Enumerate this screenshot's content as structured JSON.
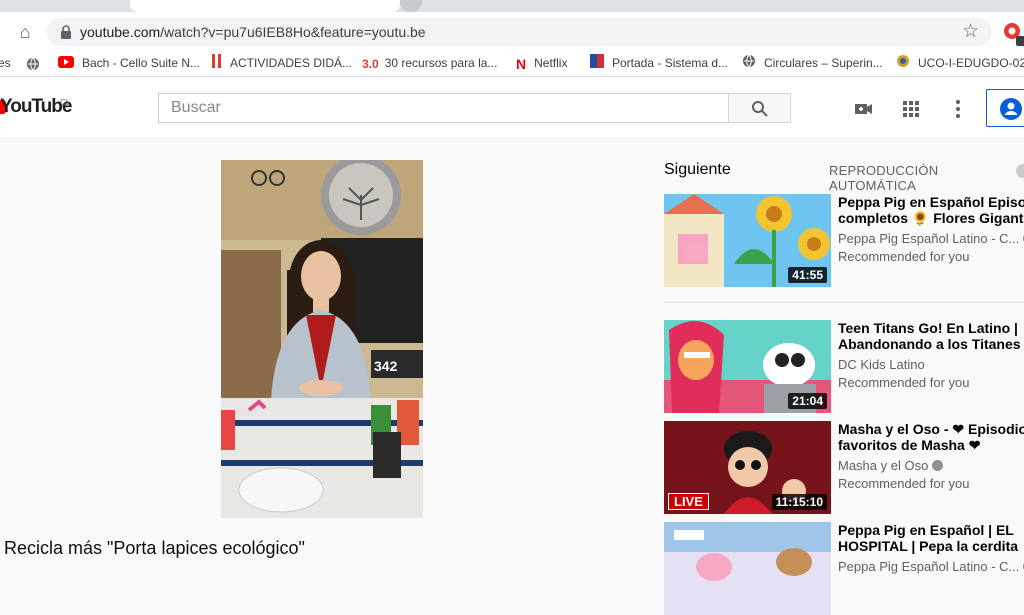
{
  "browser": {
    "url_host": "youtube.com",
    "url_path": "/watch?v=pu7u6IEB8Ho&feature=youtu.be",
    "bookmarks": [
      {
        "label": "es",
        "icon": "none"
      },
      {
        "label": "Bach - Cello Suite N...",
        "icon": "youtube-icon"
      },
      {
        "label": "ACTIVIDADES DIDÁ...",
        "icon": "bars-icon"
      },
      {
        "label": "30 recursos para la...",
        "icon": "30-icon",
        "icon_text": "3.0"
      },
      {
        "label": "Netflix",
        "icon": "netflix-icon",
        "icon_text": "N"
      },
      {
        "label": "Portada - Sistema d...",
        "icon": "flag-icon"
      },
      {
        "label": "Circulares – Superin...",
        "icon": "globe-icon"
      },
      {
        "label": "UCO-I-EDUGDO-02...",
        "icon": "seal-icon"
      }
    ]
  },
  "youtube": {
    "logo_text": "YouTube",
    "region": "CL",
    "search_placeholder": "Buscar"
  },
  "video": {
    "title": "Recicla más \"Porta lapices ecológico\"",
    "scoreboard": "342"
  },
  "sidebar": {
    "next_label": "Siguiente",
    "autoplay_label": "REPRODUCCIÓN AUTOMÁTICA",
    "items": [
      {
        "title_line1": "Peppa Pig en Español Episodios",
        "title_line2": "completos 🌻 Flores Gigantes",
        "channel": "Peppa Pig Español Latino - C...",
        "rec": "Recommended for you",
        "duration": "41:55"
      },
      {
        "title_line1": "Teen Titans Go! En Latino |",
        "title_line2": "Abandonando a los Titanes | D",
        "channel": "DC Kids Latino",
        "rec": "Recommended for you",
        "duration": "21:04"
      },
      {
        "title_line1": "Masha y el Oso - ❤ Episodios",
        "title_line2": "favoritos de Masha ❤",
        "channel": "Masha y el Oso",
        "rec": "Recommended for you",
        "duration": "11:15:10",
        "badge": "LIVE"
      },
      {
        "title_line1": "Peppa Pig en Español | EL",
        "title_line2": "HOSPITAL | Pepa la cerdita",
        "channel": "Peppa Pig Español Latino - C...",
        "rec": "",
        "duration": ""
      }
    ]
  },
  "colors": {
    "youtube_red": "#ff0000",
    "signin_blue": "#065fd4"
  }
}
